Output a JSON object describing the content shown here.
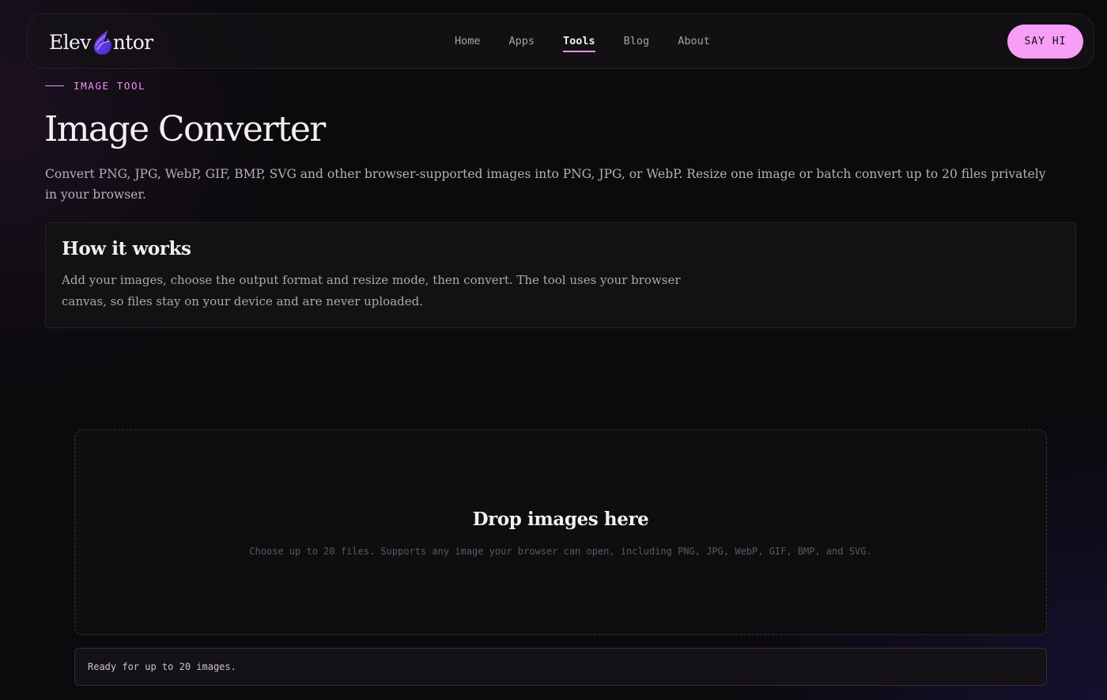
{
  "brand": {
    "logo_left": "Elev",
    "logo_right": "ntor",
    "accent": "#f79ef7",
    "logo_gradient": [
      "#7b3cf0",
      "#3f2bd6"
    ]
  },
  "nav": {
    "links": [
      {
        "label": "Home",
        "active": false
      },
      {
        "label": "Apps",
        "active": false
      },
      {
        "label": "Tools",
        "active": true
      },
      {
        "label": "Blog",
        "active": false
      },
      {
        "label": "About",
        "active": false
      }
    ],
    "cta_label": "SAY HI"
  },
  "hero": {
    "eyebrow": "IMAGE TOOL",
    "title": "Image Converter",
    "description": "Convert PNG, JPG, WebP, GIF, BMP, SVG and other browser-supported images into PNG, JPG, or WebP. Resize one image or batch convert up to 20 files privately in your browser."
  },
  "how_it_works": {
    "title": "How it works",
    "text": "Add your images, choose the output format and resize mode, then convert. The tool uses your browser canvas, so files stay on your device and are never uploaded."
  },
  "dropzone": {
    "title": "Drop images here",
    "subtitle": "Choose up to 20 files. Supports any image your browser can open, including PNG, JPG, WebP, GIF, BMP, and SVG."
  },
  "status": {
    "text": "Ready for up to 20 images."
  }
}
